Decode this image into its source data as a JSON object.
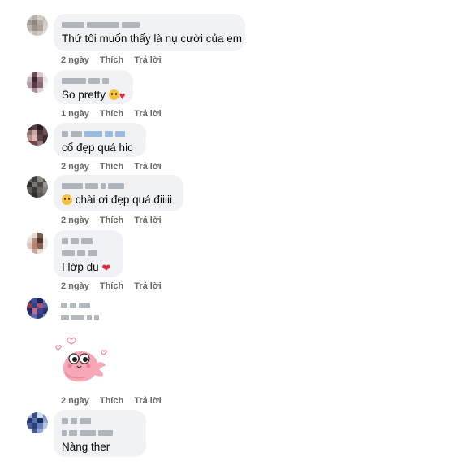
{
  "comments": [
    {
      "text": "Thứ tôi muốn thấy là nụ cười của em",
      "time": "2 ngày",
      "like": "Thích",
      "reply": "Trả lời"
    },
    {
      "text": "So pretty",
      "time": "1 ngày",
      "like": "Thích",
      "reply": "Trả lời",
      "emojis": [
        "pleading-face-emoji",
        "sparkling-heart-emoji"
      ]
    },
    {
      "text": "cổ đẹp quá hic",
      "time": "2 ngày",
      "like": "Thích",
      "reply": "Trả lời"
    },
    {
      "text": "chài ơi đẹp quá điiiii",
      "time": "2 ngày",
      "like": "Thích",
      "reply": "Trả lời",
      "emojis": [
        "pleading-face-emoji"
      ]
    },
    {
      "text": "I lớp du",
      "time": "2 ngày",
      "like": "Thích",
      "reply": "Trả lời",
      "emojis": [
        "red-heart-emoji"
      ]
    },
    {
      "text": "",
      "time": "2 ngày",
      "like": "Thích",
      "reply": "Trả lời",
      "sticker": "pink-shrimp-sticker"
    },
    {
      "text": "Nàng ther",
      "time": "",
      "like": "",
      "reply": ""
    }
  ],
  "colors": {
    "bubble": "#f0f2f5",
    "meta": "#65676b",
    "heart": "#e8283c"
  }
}
